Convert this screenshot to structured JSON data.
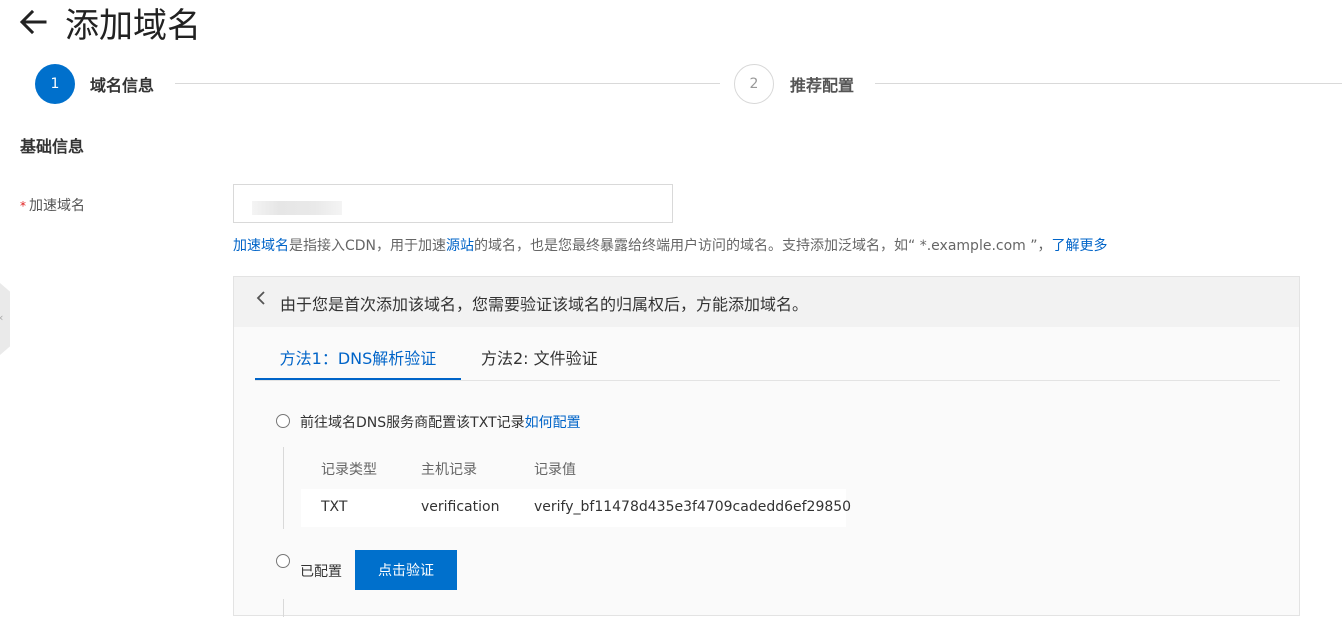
{
  "header": {
    "back_icon": "arrow-left-icon",
    "title": "添加域名"
  },
  "steps": [
    {
      "number": "1",
      "label": "域名信息",
      "active": true
    },
    {
      "number": "2",
      "label": "推荐配置",
      "active": false
    }
  ],
  "section": {
    "title": "基础信息"
  },
  "form": {
    "domain_label": "加速域名",
    "required_mark": "*",
    "domain_value": ""
  },
  "help": {
    "link1": "加速域名",
    "text1": "是指接入CDN，用于加速",
    "link2": "源站",
    "text2": "的域名，也是您最终暴露给终端用户访问的域名。支持添加泛域名，如“ *.example.com ”，",
    "link3": "了解更多"
  },
  "verify_panel": {
    "collapse_icon": "chevron-left-icon",
    "message": "由于您是首次添加该域名，您需要验证该域名的归属权后，方能添加域名。",
    "tabs": [
      {
        "label": "方法1：DNS解析验证",
        "active": true
      },
      {
        "label": "方法2: 文件验证",
        "active": false
      }
    ],
    "option1": {
      "text": "前往域名DNS服务商配置该TXT记录",
      "link": "如何配置"
    },
    "table": {
      "headers": [
        "记录类型",
        "主机记录",
        "记录值"
      ],
      "rows": [
        [
          "TXT",
          "verification",
          "verify_bf11478d435e3f4709cadedd6ef29850"
        ]
      ]
    },
    "option2": {
      "text": "已配置",
      "button": "点击验证"
    }
  },
  "colors": {
    "primary": "#0070cc",
    "link": "#0064c8",
    "required": "#e02020"
  }
}
